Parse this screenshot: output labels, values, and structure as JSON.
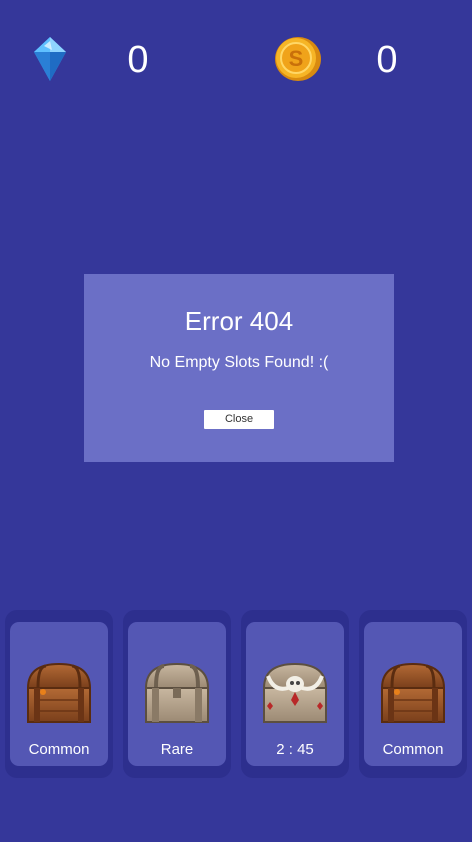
{
  "currency": {
    "gems": {
      "icon": "diamond-gem-icon",
      "value": "0",
      "color": "#4fb4ff"
    },
    "coins": {
      "icon": "gold-coin-icon",
      "value": "0",
      "color": "#f2a51a"
    }
  },
  "dialog": {
    "title": "Error 404",
    "message": "No Empty Slots Found! :(",
    "close_label": "Close"
  },
  "slots": [
    {
      "label": "Common",
      "chest": "wooden-chest-icon"
    },
    {
      "label": "Rare",
      "chest": "stone-chest-icon"
    },
    {
      "label": "2 : 45",
      "chest": "skull-chest-icon"
    },
    {
      "label": "Common",
      "chest": "wooden-chest-icon"
    }
  ],
  "colors": {
    "background": "#35379a",
    "dialog": "#6b6fc6",
    "slot_frame": "#2d2f8e",
    "slot_card": "#5457b4"
  }
}
